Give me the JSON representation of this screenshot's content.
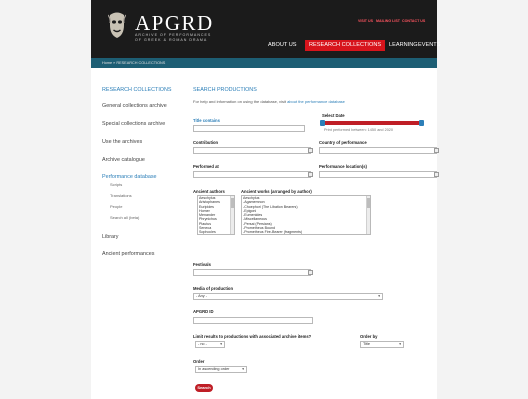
{
  "header": {
    "logo_title": "APGRD",
    "logo_sub1": "ARCHIVE OF PERFORMANCES",
    "logo_sub2": "OF GREEK & ROMAN DRAMA",
    "utility_links": [
      "VISIT US",
      "MAILING LIST",
      "CONTACT US"
    ],
    "nav": [
      "ABOUT US",
      "RESEARCH COLLECTIONS",
      "LEARNING",
      "EVENTS"
    ],
    "active_nav": "RESEARCH COLLECTIONS",
    "accent_color": "#d7141c",
    "subbar_color": "#1d5e74"
  },
  "breadcrumb": "Home » RESEARCH COLLECTIONS",
  "sidebar": {
    "items": [
      {
        "label": "RESEARCH COLLECTIONS"
      },
      {
        "label": "General collections archive"
      },
      {
        "label": "Special collections archive"
      },
      {
        "label": "Use the archives"
      },
      {
        "label": "Archive catalogue"
      },
      {
        "label": "Performance database"
      },
      {
        "label": "Scripts"
      },
      {
        "label": "Translations"
      },
      {
        "label": "People"
      },
      {
        "label": "Search all (beta)"
      },
      {
        "label": "Library"
      },
      {
        "label": "Ancient performances"
      }
    ]
  },
  "main": {
    "title": "SEARCH PRODUCTIONS",
    "help_prefix": "For help and information on using the database, visit",
    "help_link": "about the performance database",
    "labels": {
      "title_contains": "Title contains",
      "select_date": "Select Date",
      "contribution": "Contribution",
      "country": "Country of performance",
      "performed_at": "Performed at",
      "perf_location": "Performance location(s)",
      "ancient_authors": "Ancient authors",
      "ancient_works": "Ancient works (arranged by author)",
      "festivals": "Festivals",
      "media": "Media of production",
      "apgrd_id": "APGRD ID",
      "limit": "Limit results to productions with associated archive items?",
      "order_by": "Order by",
      "order": "Order"
    },
    "date_hint": "Print performed between: 1450 and 2020",
    "authors": [
      "Aeschylus",
      "Aristophanes",
      "Euripides",
      "Homer",
      "Menander",
      "Phrynichus",
      "Plautus",
      "Seneca",
      "Sophocles"
    ],
    "works": [
      "Aeschylus",
      "-Agamemnon",
      "-Choephori (The Libation Bearers)",
      "-Epigoni",
      "-Eumenides",
      "-Miscellaneous",
      "-Persai (Persians)",
      "-Prometheus Bound",
      "-Prometheus Fire-Bearer (fragments)"
    ],
    "media_value": "- Any -",
    "limit_value": "- no -",
    "order_by_value": "Title",
    "order_value": "In ascending order",
    "search_label": "Search"
  }
}
